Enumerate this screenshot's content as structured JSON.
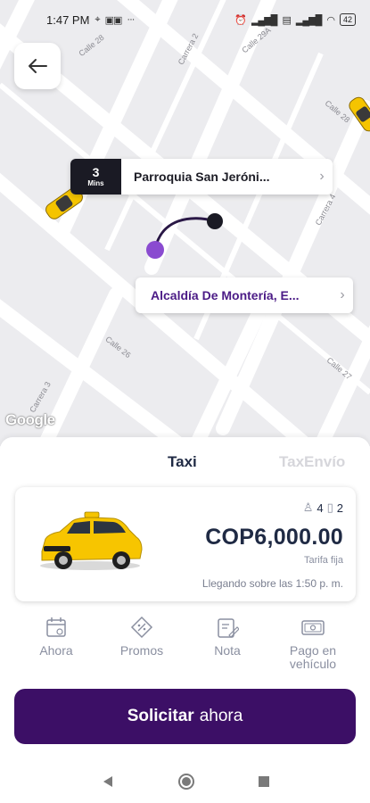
{
  "status_bar": {
    "time": "1:47 PM",
    "battery": "42"
  },
  "map": {
    "streets": [
      "Calle 28",
      "Carrera 2",
      "Calle 29A",
      "Calle 28",
      "Carrera 4",
      "Calle 26",
      "Carrera 3",
      "Calle 27"
    ],
    "google_logo": "Google"
  },
  "pickup": {
    "eta_value": "3",
    "eta_unit": "Mins",
    "name": "Parroquia San Jeróni..."
  },
  "destination": {
    "name": "Alcaldía De Montería, E..."
  },
  "tabs": [
    {
      "label": "Taxi",
      "active": true
    },
    {
      "label": "TaxEnvío",
      "active": false
    }
  ],
  "fare": {
    "passengers": "4",
    "luggage": "2",
    "price": "COP6,000.00",
    "fare_type": "Tarifa fija",
    "arrival": "Llegando sobre las 1:50 p. m."
  },
  "options": [
    {
      "label": "Ahora",
      "icon": "calendar-icon"
    },
    {
      "label": "Promos",
      "icon": "tag-icon"
    },
    {
      "label": "Nota",
      "icon": "note-icon"
    },
    {
      "label": "Pago en vehículo",
      "icon": "cash-icon"
    }
  ],
  "request_button": {
    "strong": "Solicitar",
    "rest": "ahora"
  },
  "colors": {
    "primary": "#3c0f66",
    "accent_purple": "#7b3fc4",
    "text_dark": "#1f2a44",
    "muted": "#8a8fa0",
    "taxi_yellow": "#f5c400"
  }
}
